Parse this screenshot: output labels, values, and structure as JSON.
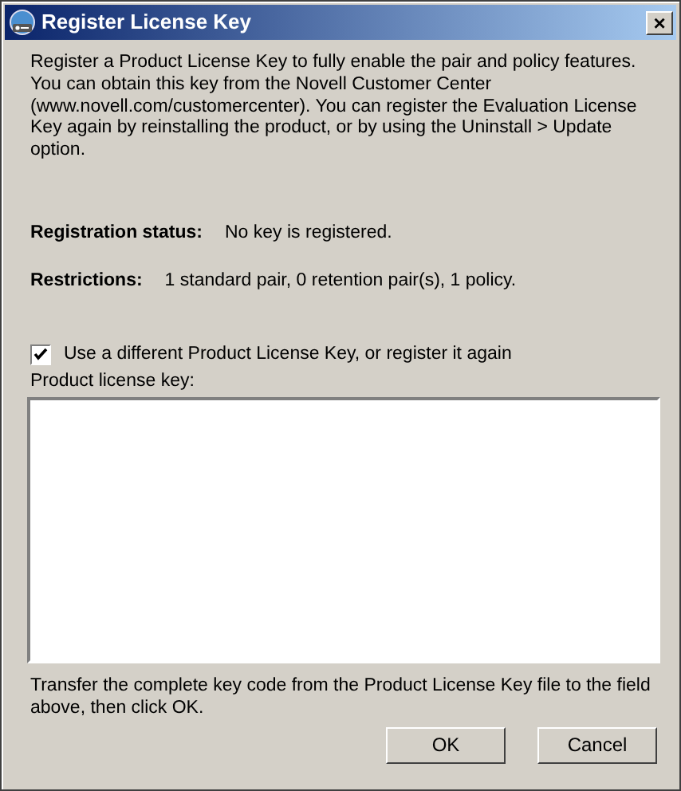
{
  "window": {
    "title": "Register License Key",
    "close": "×"
  },
  "intro": "Register a Product License Key to fully enable the pair and policy features. You can obtain this key from the Novell Customer Center (www.novell.com/customercenter). You can register the Evaluation License Key again by reinstalling the product, or by using the Uninstall > Update option.",
  "info": [
    {
      "label": "Registration status:",
      "value": "No key is registered."
    },
    {
      "label": "Restrictions:",
      "value": "1 standard pair, 0 retention pair(s),  1 policy."
    }
  ],
  "option": {
    "label": "Use a different Product License Key, or register it again",
    "checked": true
  },
  "key_field": {
    "label": "Product license key:"
  },
  "hint": "Transfer the complete key code from the Product License Key file to the field above, then click OK.",
  "buttons": [
    "OK",
    "Cancel"
  ]
}
